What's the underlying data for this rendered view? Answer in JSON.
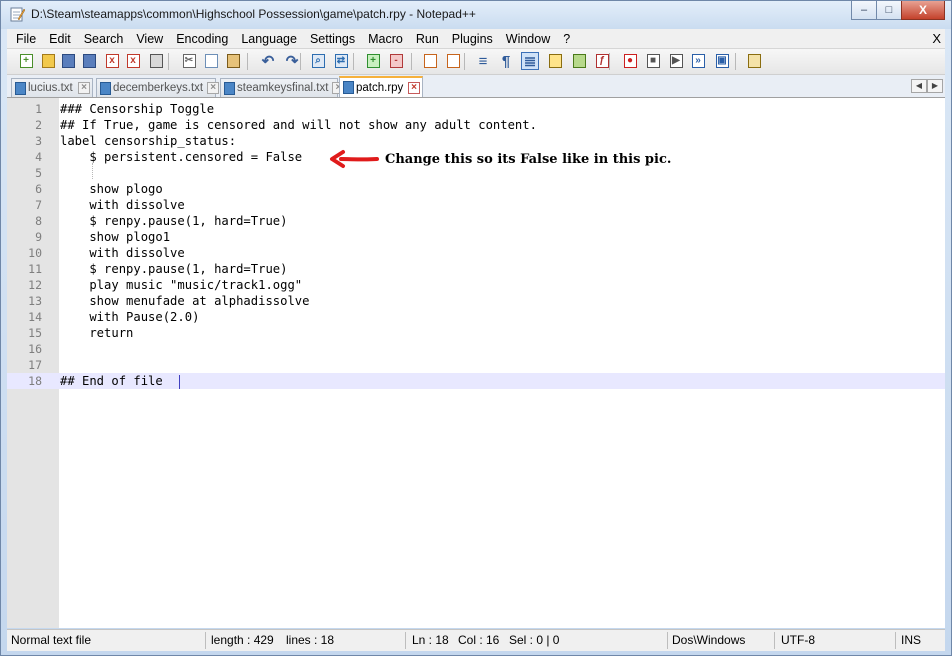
{
  "window": {
    "title": "D:\\Steam\\steamapps\\common\\Highschool Possession\\game\\patch.rpy - Notepad++",
    "minimize": "–",
    "maximize": "□",
    "close": "X"
  },
  "menu": {
    "items": [
      "File",
      "Edit",
      "Search",
      "View",
      "Encoding",
      "Language",
      "Settings",
      "Macro",
      "Run",
      "Plugins",
      "Window",
      "?"
    ],
    "close_doc": "X"
  },
  "toolbar": {
    "icons": [
      "new-file-icon",
      "open-file-icon",
      "save-icon",
      "save-all-icon",
      "close-icon",
      "close-all-icon",
      "print-icon",
      "cut-icon",
      "copy-icon",
      "paste-icon",
      "undo-icon",
      "redo-icon",
      "find-icon",
      "replace-icon",
      "zoom-in-icon",
      "zoom-out-icon",
      "sync-v-icon",
      "sync-h-icon",
      "word-wrap-icon",
      "show-all-chars-icon",
      "indent-guide-icon",
      "user-lang-icon",
      "doc-map-icon",
      "function-list-icon",
      "record-macro-icon",
      "stop-macro-icon",
      "play-macro-icon",
      "run-macro-multiple-icon",
      "save-macro-icon",
      "spell-check-icon"
    ],
    "active_icon": "indent-guide-icon"
  },
  "tabs": [
    {
      "label": "lucius.txt",
      "active": false
    },
    {
      "label": "decemberkeys.txt",
      "active": false
    },
    {
      "label": "steamkeysfinal.txt",
      "active": false
    },
    {
      "label": "patch.rpy",
      "active": true
    }
  ],
  "editor": {
    "lines": [
      {
        "n": "1",
        "text": "### Censorship Toggle"
      },
      {
        "n": "2",
        "text": "## If True, game is censored and will not show any adult content."
      },
      {
        "n": "3",
        "text": "label censorship_status:"
      },
      {
        "n": "4",
        "text": "    $ persistent.censored = False"
      },
      {
        "n": "5",
        "text": ""
      },
      {
        "n": "6",
        "text": "    show plogo"
      },
      {
        "n": "7",
        "text": "    with dissolve"
      },
      {
        "n": "8",
        "text": "    $ renpy.pause(1, hard=True)"
      },
      {
        "n": "9",
        "text": "    show plogo1"
      },
      {
        "n": "10",
        "text": "    with dissolve"
      },
      {
        "n": "11",
        "text": "    $ renpy.pause(1, hard=True)"
      },
      {
        "n": "12",
        "text": "    play music \"music/track1.ogg\""
      },
      {
        "n": "13",
        "text": "    show menufade at alphadissolve"
      },
      {
        "n": "14",
        "text": "    with Pause(2.0)"
      },
      {
        "n": "15",
        "text": "    return"
      },
      {
        "n": "16",
        "text": ""
      },
      {
        "n": "17",
        "text": ""
      },
      {
        "n": "18",
        "text": "## End of file "
      }
    ],
    "current_line": "18",
    "annotation": "Change this so its False like in this pic.",
    "arrow_color": "#e01b1b"
  },
  "status": {
    "type": "Normal text file",
    "length": "length : 429",
    "lines": "lines : 18",
    "ln": "Ln : 18",
    "col": "Col : 16",
    "sel": "Sel : 0 | 0",
    "eol": "Dos\\Windows",
    "encoding": "UTF-8",
    "mode": "INS"
  }
}
